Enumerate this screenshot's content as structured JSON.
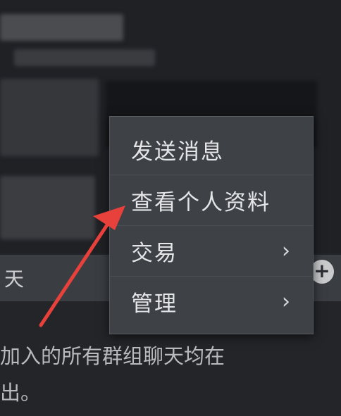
{
  "chat": {
    "label": "天",
    "add_icon": "plus-circle-icon"
  },
  "info_text_lines": [
    "加入的所有群组聊天均在",
    "出。"
  ],
  "context_menu": {
    "items": [
      {
        "label": "发送消息",
        "has_submenu": false
      },
      {
        "label": "查看个人资料",
        "has_submenu": false
      },
      {
        "label": "交易",
        "has_submenu": true,
        "chevron": "›"
      },
      {
        "label": "管理",
        "has_submenu": true,
        "chevron": "›"
      }
    ]
  },
  "annotation": {
    "arrow_color": "#e8403a"
  }
}
